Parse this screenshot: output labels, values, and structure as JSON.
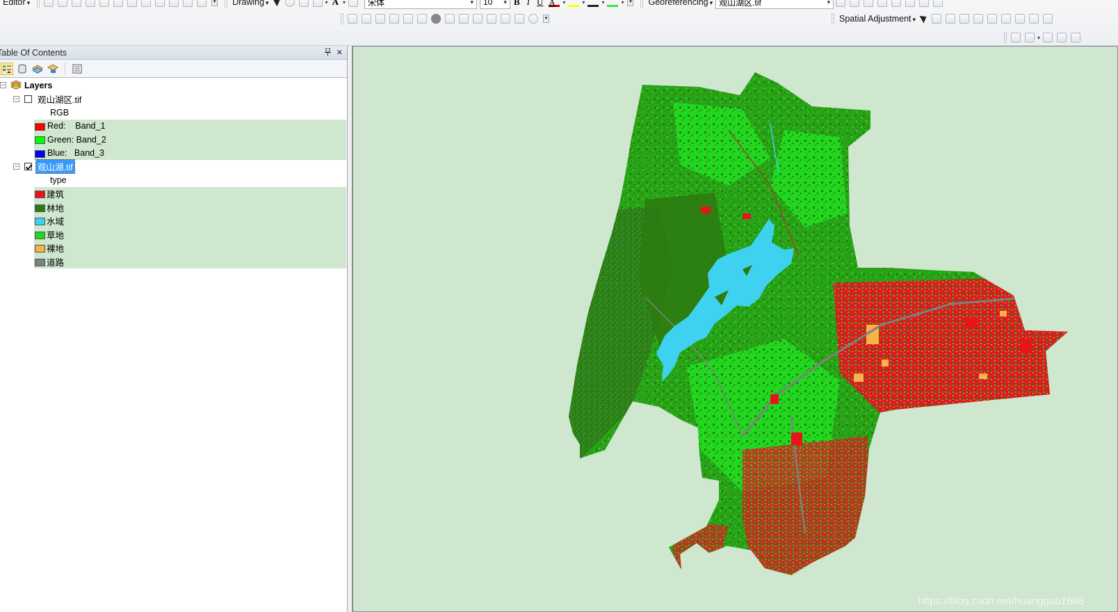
{
  "toolbar": {
    "editor_label": "Editor",
    "drawing_label": "Drawing",
    "font_name": "宋体",
    "font_size": "10",
    "bold": "B",
    "italic": "I",
    "underline": "U",
    "text_color_glyph": "A",
    "georeferencing_label": "Georeferencing",
    "layer_combo_value": "观山湖区.tif",
    "spatial_adjustment_label": "Spatial Adjustment"
  },
  "toc": {
    "title": "Table Of Contents",
    "pin": "ᵖ",
    "close": "✕",
    "root_label": "Layers",
    "layers": [
      {
        "name": "观山湖区.tif",
        "checked": false,
        "render_label": "RGB",
        "items": [
          {
            "label": "Red:    Band_1",
            "color": "#ff0000"
          },
          {
            "label": "Green: Band_2",
            "color": "#00ff00"
          },
          {
            "label": "Blue:   Band_3",
            "color": "#0000ff"
          }
        ]
      },
      {
        "name": "观山湖.tif",
        "checked": true,
        "render_label": "type",
        "items": [
          {
            "label": "建筑",
            "color": "#e8141b"
          },
          {
            "label": "林地",
            "color": "#2d7a10"
          },
          {
            "label": "水域",
            "color": "#3fd2f0"
          },
          {
            "label": "草地",
            "color": "#1fd81f"
          },
          {
            "label": "裸地",
            "color": "#f7b24a"
          },
          {
            "label": "道路",
            "color": "#808080"
          }
        ]
      }
    ]
  },
  "map": {
    "background": "#cfe6cf",
    "watermark": "https://blog.csdn.net/huangguo1688"
  }
}
